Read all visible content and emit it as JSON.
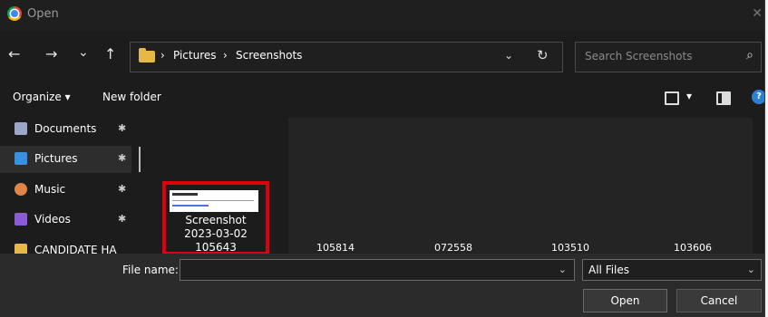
{
  "window": {
    "title": "Open",
    "close_glyph": "✕"
  },
  "nav": {
    "back": "←",
    "forward": "→",
    "recent": "⌄",
    "up": "↑",
    "breadcrumb": [
      "Pictures",
      "Screenshots"
    ],
    "separator": "›",
    "dropdown": "⌄",
    "refresh": "↻"
  },
  "search": {
    "placeholder": "Search Screenshots",
    "icon": "⌕"
  },
  "toolbar": {
    "organize": "Organize ▾",
    "new_folder": "New folder",
    "view_drop": "▾",
    "help": "?"
  },
  "sidebar": {
    "items": [
      {
        "label": "Documents",
        "pin": "✱",
        "icon_color": "#9aa7c9"
      },
      {
        "label": "Pictures",
        "pin": "✱",
        "icon_color": "#3b8fe0"
      },
      {
        "label": "Music",
        "pin": "✱",
        "icon_color": "#e08548"
      },
      {
        "label": "Videos",
        "pin": "✱",
        "icon_color": "#8a5bd6"
      },
      {
        "label": "CANDIDATE HA",
        "icon_color": "#e6b84a"
      }
    ]
  },
  "files": {
    "selected": {
      "line1": "Screenshot",
      "line2": "2023-03-02",
      "line3": "105643"
    },
    "others": [
      "105814",
      "072558",
      "103510",
      "103606"
    ]
  },
  "footer": {
    "file_name_label": "File name:",
    "file_name_value": "",
    "file_type": "All Files",
    "open": "Open",
    "cancel": "Cancel",
    "drop": "⌄"
  },
  "colors": {
    "selection_highlight": "#e0000b",
    "accent": "#2d7fd3"
  }
}
